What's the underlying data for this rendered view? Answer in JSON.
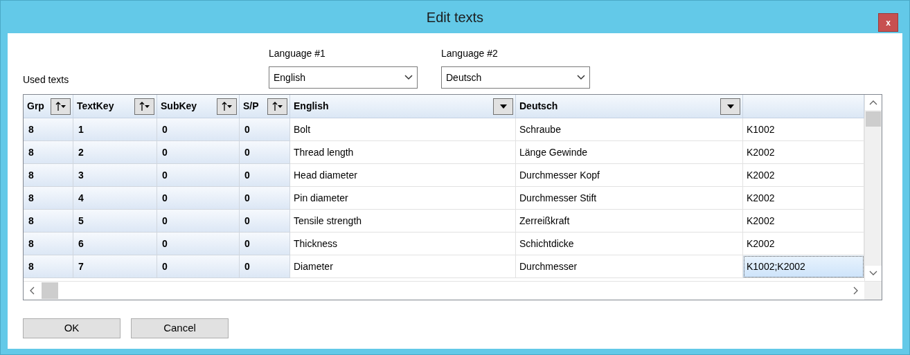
{
  "window": {
    "title": "Edit texts",
    "close_label": "x"
  },
  "languages": [
    {
      "label": "Language #1",
      "value": "English"
    },
    {
      "label": "Language #2",
      "value": "Deutsch"
    }
  ],
  "used_texts_label": "Used texts",
  "columns": [
    {
      "label": "Grp",
      "kind": "sort"
    },
    {
      "label": "TextKey",
      "kind": "sort"
    },
    {
      "label": "SubKey",
      "kind": "sort"
    },
    {
      "label": "S/P",
      "kind": "sort"
    },
    {
      "label": "English",
      "kind": "filter"
    },
    {
      "label": "Deutsch",
      "kind": "filter"
    },
    {
      "kind": "plain"
    }
  ],
  "rows": [
    {
      "cells": [
        "8",
        "1",
        "0",
        "0",
        "Bolt",
        "Schraube"
      ],
      "column_7": {
        "text": "K1002",
        "selected": false
      }
    },
    {
      "cells": [
        "8",
        "2",
        "0",
        "0",
        "Thread length",
        "Länge Gewinde"
      ],
      "column_7": {
        "text": "K2002",
        "selected": false
      }
    },
    {
      "cells": [
        "8",
        "3",
        "0",
        "0",
        "Head diameter",
        "Durchmesser Kopf"
      ],
      "column_7": {
        "text": "K2002",
        "selected": false
      }
    },
    {
      "cells": [
        "8",
        "4",
        "0",
        "0",
        "Pin diameter",
        "Durchmesser Stift"
      ],
      "column_7": {
        "text": "K2002",
        "selected": false
      }
    },
    {
      "cells": [
        "8",
        "5",
        "0",
        "0",
        "Tensile strength",
        "Zerreißkraft"
      ],
      "column_7": {
        "text": "K2002",
        "selected": false
      }
    },
    {
      "cells": [
        "8",
        "6",
        "0",
        "0",
        "Thickness",
        "Schichtdicke"
      ],
      "column_7": {
        "text": "K2002",
        "selected": false
      }
    },
    {
      "cells": [
        "8",
        "7",
        "0",
        "0",
        "Diameter",
        "Durchmesser"
      ],
      "column_7": {
        "text": "K1002;K2002",
        "selected": true
      }
    }
  ],
  "buttons": [
    "OK",
    "Cancel"
  ]
}
